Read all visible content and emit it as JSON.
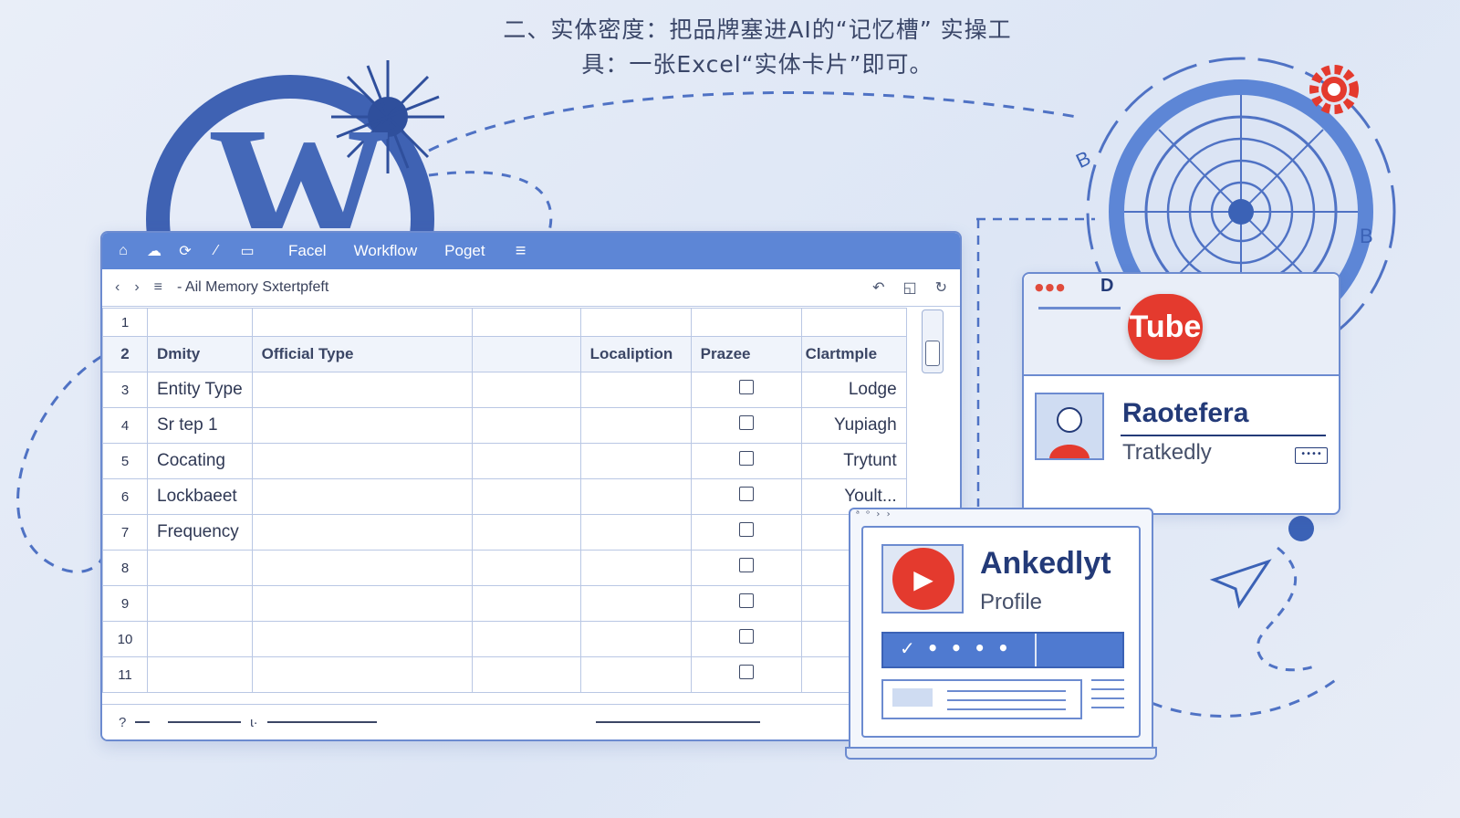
{
  "headline": {
    "line1": "二、实体密度：把品牌塞进AI的“记忆槽” 实操工",
    "line2": "具：一张Excel“实体卡片”即可。"
  },
  "colors": {
    "accent": "#5d86d6",
    "dark_blue": "#233a78",
    "brand_red": "#e43a2e",
    "background": "#e3eaf6"
  },
  "wp_logo": {
    "glyph": "W"
  },
  "spreadsheet": {
    "toolbar": {
      "icons": [
        "home-icon",
        "cloud-icon",
        "refresh-icon",
        "pen-icon",
        "window-icon"
      ],
      "menu": [
        "Facel",
        "Workflow",
        "Poget"
      ],
      "hamburger_icon": "menu-icon"
    },
    "address": {
      "back_icon": "chevron-left-icon",
      "forward_icon": "chevron-right-icon",
      "list_icon": "list-icon",
      "title": "- Ail Memory Sxtert͏pfeft",
      "right_icons": [
        "undo-icon",
        "bookmark-icon",
        "sync-icon"
      ]
    },
    "row_numbers": [
      "1",
      "2",
      "3",
      "4",
      "5",
      "6",
      "7",
      "8",
      "9",
      "10",
      "11"
    ],
    "headers": [
      "Dmity",
      "Official Type",
      "",
      "Localiption",
      "Prazee",
      "Clartmple"
    ],
    "rows": [
      {
        "col1": "Entity Type",
        "last": "Lodge"
      },
      {
        "col1": "Sr tep 1",
        "last": "Yupiagh"
      },
      {
        "col1": "Cocating",
        "last": "Trytunt"
      },
      {
        "col1": "Lockbaeet",
        "last": "Yoult..."
      },
      {
        "col1": "Frequency",
        "last": ""
      },
      {
        "col1": "",
        "last": ""
      },
      {
        "col1": "",
        "last": ""
      },
      {
        "col1": "",
        "last": ""
      },
      {
        "col1": "",
        "last": ""
      }
    ],
    "status": {
      "left": "?",
      "mid": "ɩ·"
    }
  },
  "profile_card": {
    "badge": "Tube",
    "name": "Raotefera",
    "subtitle": "Tratkedly",
    "more": "••••",
    "header_mark": "D"
  },
  "laptop_card": {
    "toolbar": "ᵃ ᵒ › ›",
    "name": "Ankedlyt",
    "subtitle": "Profile",
    "bar_text": "✓ • • • •"
  },
  "radar": {
    "labels": [
      "B",
      "B"
    ]
  }
}
